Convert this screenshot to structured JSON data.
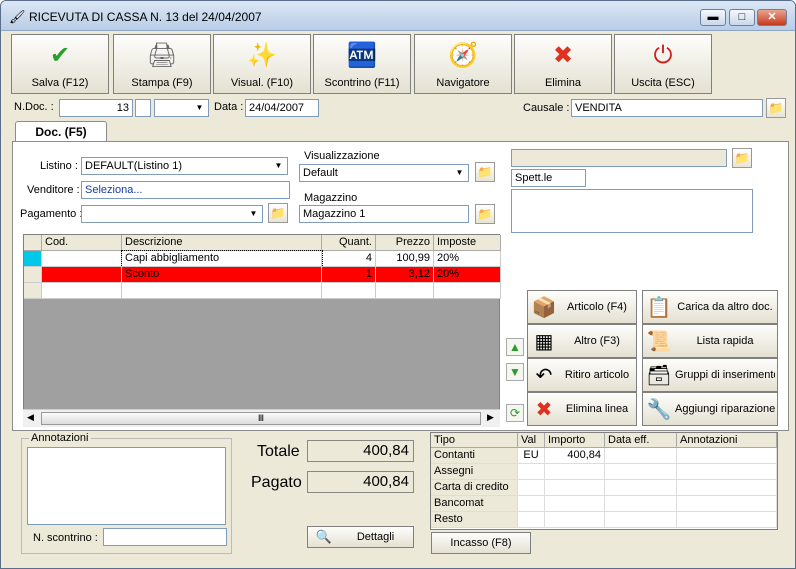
{
  "window": {
    "title": "RICEVUTA DI CASSA N. 13  del 24/04/2007"
  },
  "toolbar": [
    {
      "label": "Salva (F12)",
      "icon": "check-icon",
      "glyph": "✔",
      "color": "#2aa02a"
    },
    {
      "label": "Stampa (F9)",
      "icon": "printer-icon",
      "glyph": "🖨",
      "color": "#666666"
    },
    {
      "label": "Visual. (F10)",
      "icon": "magic-wand-icon",
      "glyph": "✨",
      "color": "#c8a000"
    },
    {
      "label": "Scontrino (F11)",
      "icon": "cash-register-icon",
      "glyph": "🏧",
      "color": "#3a6ab0"
    },
    {
      "label": "Navigatore",
      "icon": "compass-icon",
      "glyph": "🧭",
      "color": "#6a4aa0"
    },
    {
      "label": "Elimina",
      "icon": "delete-x-icon",
      "glyph": "✖",
      "color": "#e03020"
    },
    {
      "label": "Uscita (ESC)",
      "icon": "power-icon",
      "glyph": "⏻",
      "color": "#d02020"
    }
  ],
  "header": {
    "ndoc_label": "N.Doc. :",
    "ndoc_value": "13",
    "data_label": "Data :",
    "data_value": "24/04/2007",
    "causale_label": "Causale :",
    "causale_value": "VENDITA"
  },
  "tab": {
    "label": "Doc. (F5)"
  },
  "form": {
    "listino_label": "Listino :",
    "listino_value": "DEFAULT(Listino 1)",
    "venditore_label": "Venditore :",
    "venditore_value": "Seleziona...",
    "pagamento_label": "Pagamento :",
    "pagamento_value": "",
    "visualizzazione_label": "Visualizzazione",
    "visualizzazione_value": "Default",
    "magazzino_label": "Magazzino",
    "magazzino_value": "Magazzino 1",
    "cliente_value": "",
    "spett_value": "Spett.le"
  },
  "grid": {
    "columns": [
      "Cod.",
      "Descrizione",
      "Quant.",
      "Prezzo",
      "Imposte"
    ],
    "rows": [
      {
        "cod": "",
        "descrizione": "Capi abbigliamento",
        "quant": "4",
        "prezzo": "100,99",
        "imposte": "20%",
        "highlight": false
      },
      {
        "cod": "",
        "descrizione": "Sconto",
        "quant": "1",
        "prezzo": "3,12",
        "imposte": "20%",
        "highlight": true
      }
    ]
  },
  "actions": [
    {
      "label": "Articolo (F4)",
      "icon": "box-add-icon",
      "glyph": "📦"
    },
    {
      "label": "Carica da altro doc.",
      "icon": "import-doc-icon",
      "glyph": "📋"
    },
    {
      "label": "Altro (F3)",
      "icon": "grid-add-icon",
      "glyph": "▦"
    },
    {
      "label": "Lista rapida",
      "icon": "quick-list-icon",
      "glyph": "📜"
    },
    {
      "label": "Ritiro articolo",
      "icon": "undo-arrow-icon",
      "glyph": "↶"
    },
    {
      "label": "Gruppi di inserimento",
      "icon": "group-add-icon",
      "glyph": "🗃"
    },
    {
      "label": "Elimina linea",
      "icon": "delete-line-icon",
      "glyph": "✖"
    },
    {
      "label": "Aggiungi riparazione",
      "icon": "wrench-icon",
      "glyph": "🔧"
    }
  ],
  "notes": {
    "label": "Annotazioni",
    "value": "",
    "scontrino_label": "N. scontrino :",
    "scontrino_value": ""
  },
  "totals": {
    "totale_label": "Totale",
    "totale_value": "400,84",
    "pagato_label": "Pagato",
    "pagato_value": "400,84",
    "dettagli_label": "Dettagli"
  },
  "payments": {
    "columns": [
      "Tipo",
      "Val",
      "Importo",
      "Data eff.",
      "Annotazioni"
    ],
    "rows": [
      {
        "tipo": "Contanti",
        "val": "EU",
        "importo": "400,84",
        "data": "",
        "note": ""
      },
      {
        "tipo": "Assegni",
        "val": "",
        "importo": "",
        "data": "",
        "note": ""
      },
      {
        "tipo": "Carta di credito",
        "val": "",
        "importo": "",
        "data": "",
        "note": ""
      },
      {
        "tipo": "Bancomat",
        "val": "",
        "importo": "",
        "data": "",
        "note": ""
      },
      {
        "tipo": "Resto",
        "val": "",
        "importo": "",
        "data": "",
        "note": ""
      }
    ],
    "incasso_label": "Incasso (F8)"
  },
  "colors": {
    "highlight_row": "#ff0000",
    "selected_cell": "#00c8e8"
  }
}
